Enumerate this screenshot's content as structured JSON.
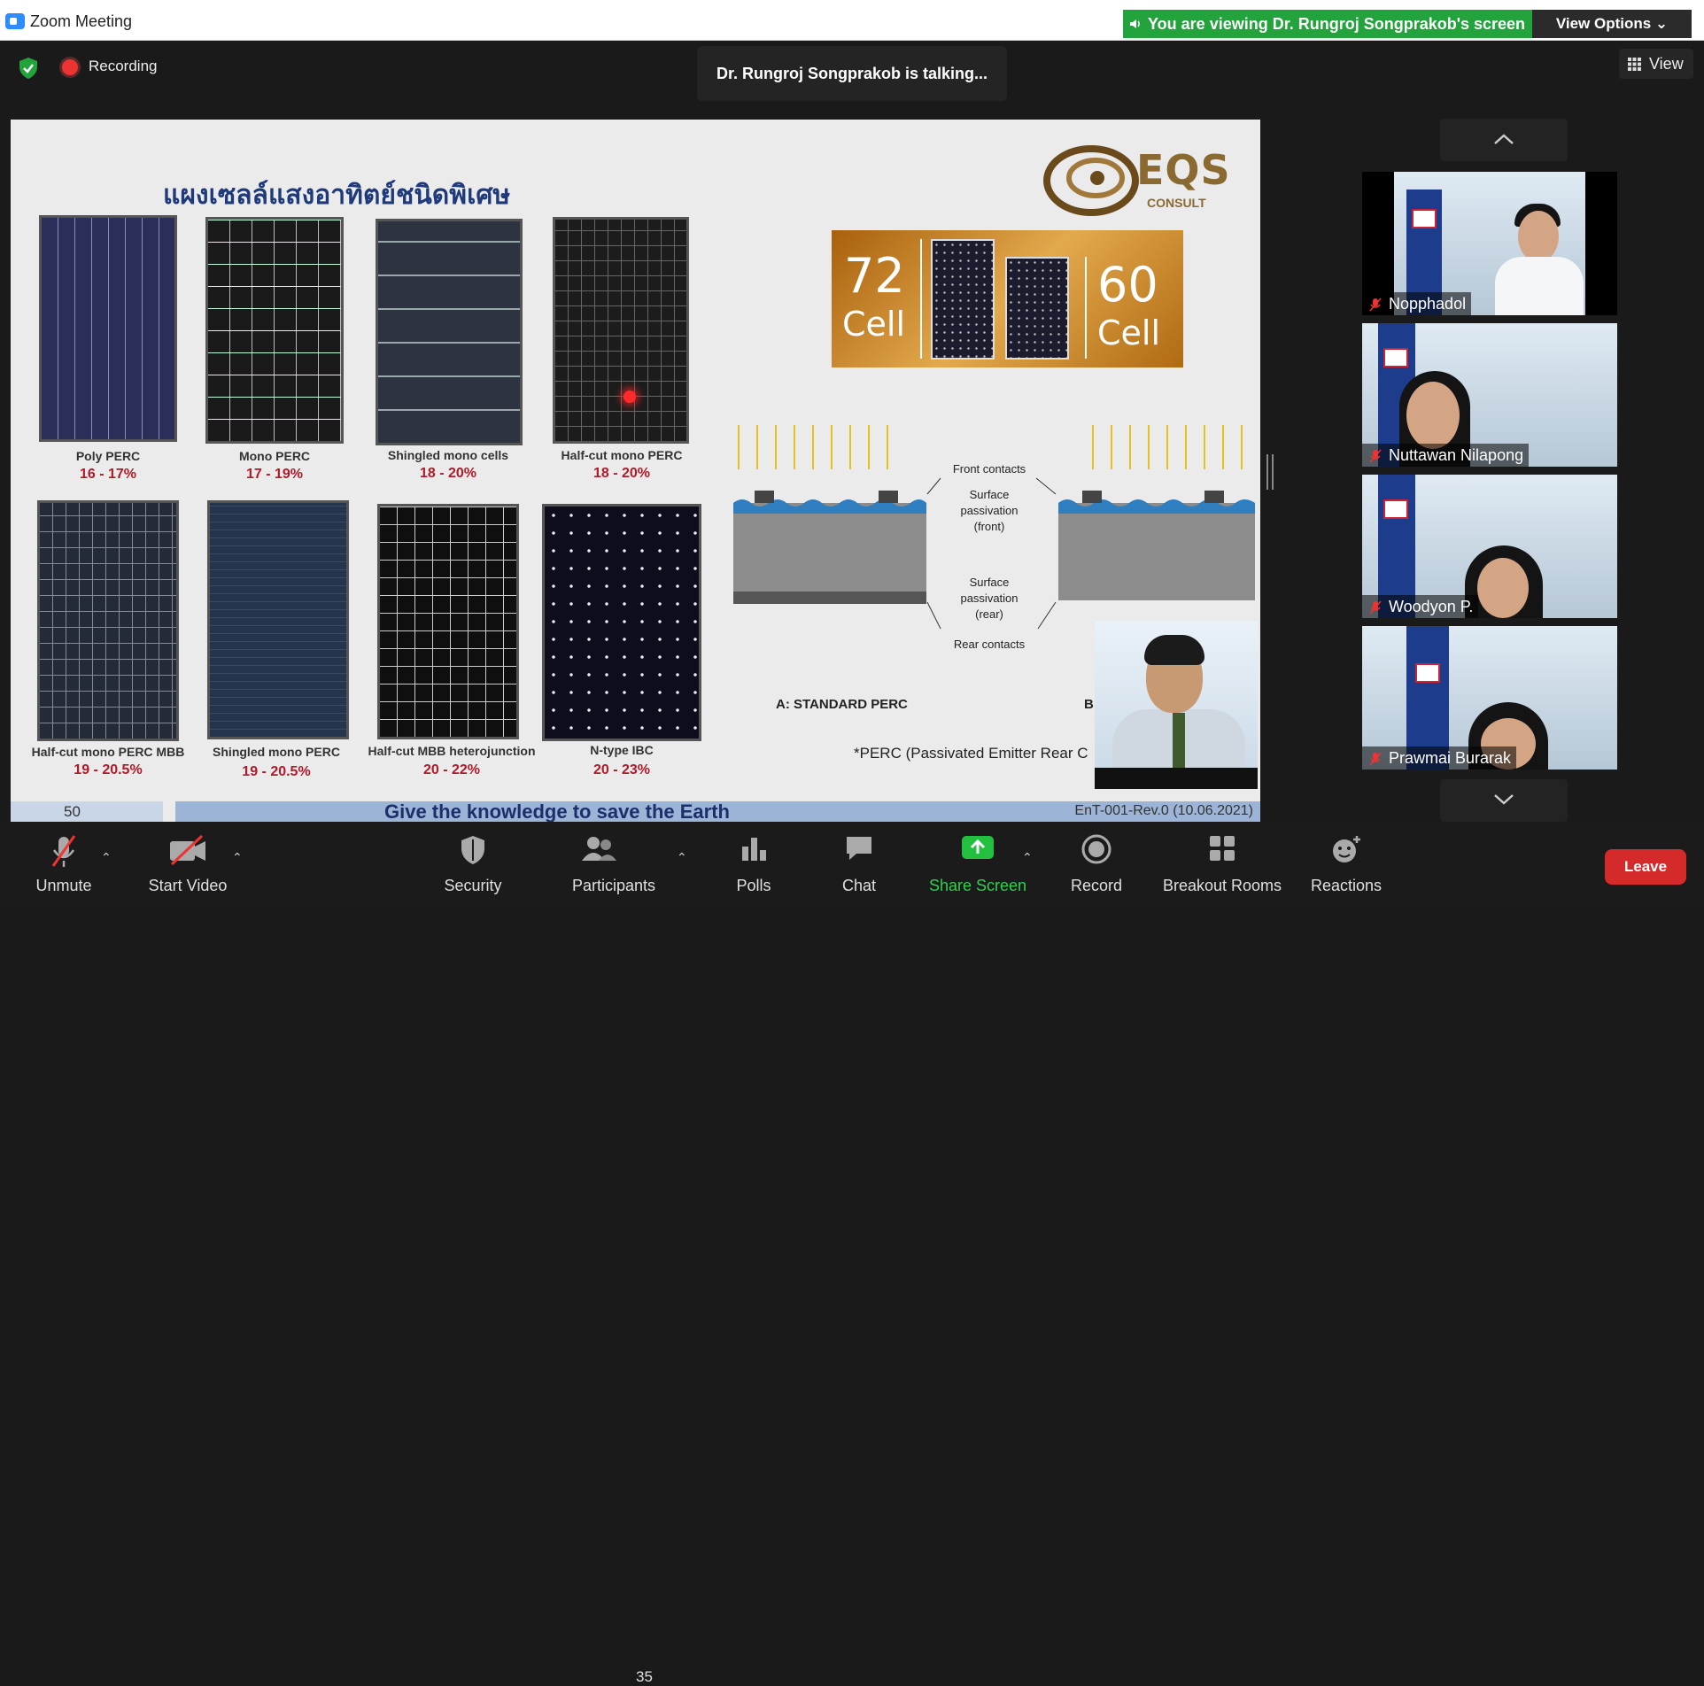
{
  "window": {
    "title": "Zoom Meeting"
  },
  "banner": {
    "viewing_text": "You are viewing Dr. Rungroj Songprakob's screen",
    "view_options": "View Options ⌄"
  },
  "status": {
    "recording_label": "Recording",
    "talking": "Dr. Rungroj Songprakob is talking...",
    "view_label": "View"
  },
  "slide": {
    "title": "แผงเซลล์แสงอาทิตย์ชนิดพิเศษ",
    "logo_text": "EQS",
    "logo_sub": "CONSULT",
    "panels": [
      {
        "label": "Poly PERC",
        "range": "16 - 17%"
      },
      {
        "label": "Mono PERC",
        "range": "17 - 19%"
      },
      {
        "label": "Shingled  mono cells",
        "range": "18 - 20%"
      },
      {
        "label": "Half-cut mono PERC",
        "range": "18 - 20%"
      },
      {
        "label": "Half-cut mono PERC MBB",
        "range": "19 - 20.5%"
      },
      {
        "label": "Shingled mono PERC",
        "range": "19 - 20.5%"
      },
      {
        "label": "Half-cut MBB heterojunction",
        "range": "20 - 22%"
      },
      {
        "label": "N-type IBC",
        "range": "20 - 23%"
      }
    ],
    "cells_left_num": "72",
    "cells_left_cap": "Cell",
    "cells_right_num": "60",
    "cells_right_cap": "Cell",
    "diagram": {
      "front_contacts": "Front contacts",
      "surface_front_1": "Surface",
      "surface_front_2": "passivation",
      "surface_front_3": "(front)",
      "surface_rear_1": "Surface",
      "surface_rear_2": "passivation",
      "surface_rear_3": "(rear)",
      "rear_contacts": "Rear contacts",
      "caption_a": "A: STANDARD PERC",
      "caption_b": "B:"
    },
    "perc_note": "*PERC (Passivated Emitter Rear C",
    "page_number": "50",
    "tagline": "Give the knowledge to save the Earth",
    "doc_ref": "EnT-001-Rev.0 (10.06.2021)"
  },
  "participants_gallery": [
    {
      "name": "Nopphadol"
    },
    {
      "name": "Nuttawan Nilapong"
    },
    {
      "name": "Woodyon P."
    },
    {
      "name": "Prawmai Burarak"
    }
  ],
  "toolbar": {
    "unmute": "Unmute",
    "start_video": "Start Video",
    "security": "Security",
    "participants": "Participants",
    "participants_count": "35",
    "polls": "Polls",
    "chat": "Chat",
    "share_screen": "Share Screen",
    "record": "Record",
    "breakout_rooms": "Breakout Rooms",
    "reactions": "Reactions",
    "leave": "Leave"
  },
  "colors": {
    "accent_green": "#23a33c",
    "leave_red": "#d42a2a",
    "toolbar_bg": "#1b1b1b",
    "slide_title": "#1f3a7a",
    "range_red": "#b01a2a"
  }
}
